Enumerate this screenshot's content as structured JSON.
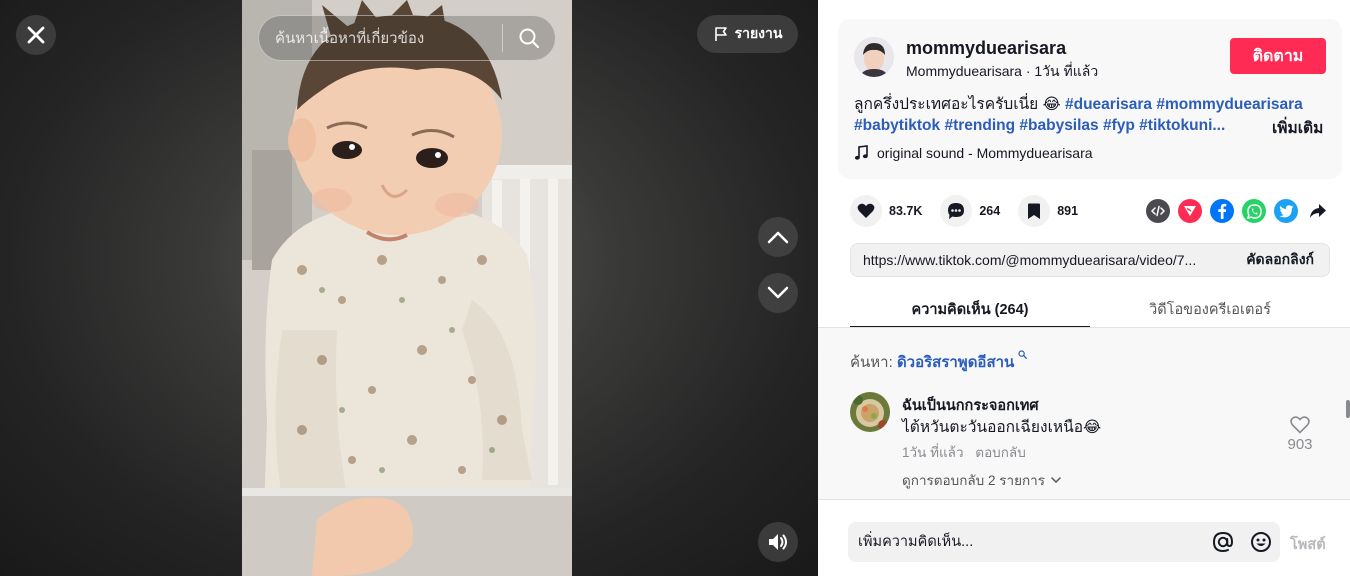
{
  "video": {
    "search_placeholder": "ค้นหาเนื้อหาที่เกี่ยวข้อง",
    "report_label": "รายงาน",
    "icons": {
      "close": "close-icon",
      "search": "search-icon",
      "report": "flag-icon",
      "prev": "chevron-up-icon",
      "next": "chevron-down-icon",
      "volume": "volume-icon"
    }
  },
  "author": {
    "username": "mommyduearisara",
    "display_name": "Mommyduearisara",
    "time_ago": "1วัน ที่แล้ว",
    "separator": " · ",
    "follow_label": "ติดตาม"
  },
  "description": {
    "text": "ลูกครึ่งประเทศอะไรครับเนี่ย 😂",
    "hashtags": [
      "#duearisara",
      "#mommyduearisara",
      "#babytiktok",
      "#trending",
      "#babysilas",
      "#fyp",
      "#tiktokuni..."
    ],
    "more_label": "เพิ่มเติม"
  },
  "sound": {
    "label": "original sound - Mommyduearisara",
    "icon": "music-note-icon"
  },
  "stats": {
    "likes": "83.7K",
    "comments": "264",
    "saves": "891"
  },
  "share_icons": [
    "embed-icon",
    "send-icon",
    "facebook-icon",
    "whatsapp-icon",
    "twitter-icon",
    "share-arrow-icon"
  ],
  "colors": {
    "accent": "#fe2c55",
    "hashtag": "#2b5db9",
    "send": "#fe2c55",
    "facebook": "#0075fa",
    "whatsapp": "#25d366",
    "twitter": "#1da1f2",
    "embed": "#4a4a4f"
  },
  "link": {
    "url": "https://www.tiktok.com/@mommyduearisara/video/7...",
    "copy_label": "คัดลอกลิงก์"
  },
  "tabs": [
    {
      "label": "ความคิดเห็น (264)",
      "active": true
    },
    {
      "label": "วิดีโอของครีเอเตอร์",
      "active": false
    }
  ],
  "search_hint": {
    "prefix": "ค้นหา: ",
    "term": "ดิวอริสราพูดอีสาน"
  },
  "comments": [
    {
      "username": "ฉันเป็นนกกระจอกเทศ",
      "text": "ไต้หวันตะวันออกเฉียงเหนือ😂",
      "time": "1วัน ที่แล้ว",
      "reply_label": "ตอบกลับ",
      "view_replies": "ดูการตอบกลับ 2 รายการ",
      "likes": "903"
    }
  ],
  "comment_bar": {
    "placeholder": "เพิ่มความคิดเห็น...",
    "post_label": "โพสต์"
  }
}
